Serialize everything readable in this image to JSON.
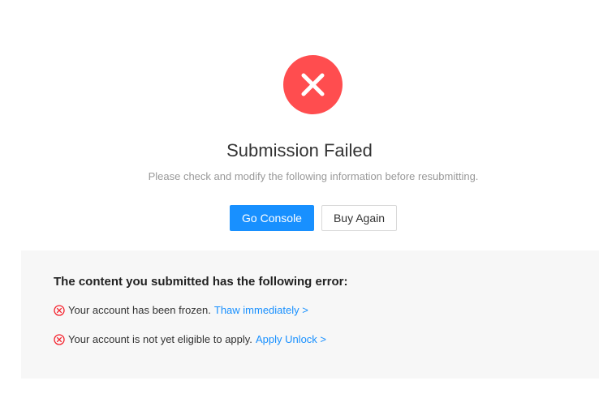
{
  "result": {
    "icon": "error-x-icon",
    "title": "Submission Failed",
    "subtitle": "Please check and modify the following information before resubmitting."
  },
  "actions": {
    "primary_label": "Go Console",
    "secondary_label": "Buy Again"
  },
  "errors": {
    "heading": "The content you submitted has the following error:",
    "items": [
      {
        "icon": "error-circle-icon",
        "text": "Your account has been frozen.",
        "link": "Thaw immediately >"
      },
      {
        "icon": "error-circle-icon",
        "text": "Your account is not yet eligible to apply.",
        "link": "Apply Unlock >"
      }
    ]
  },
  "colors": {
    "error": "#f5222d",
    "error_circle": "#ff4d4f",
    "primary": "#1890ff",
    "panel_bg": "#f7f7f7"
  }
}
